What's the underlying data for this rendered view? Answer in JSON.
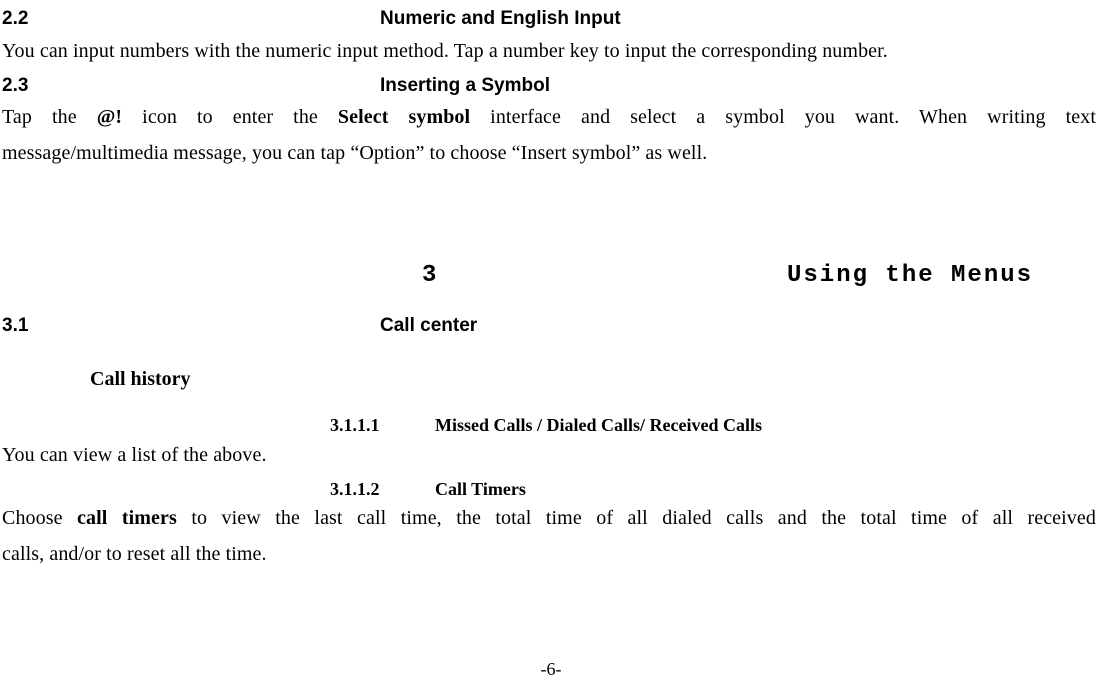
{
  "s22": {
    "num": "2.2",
    "title": "Numeric and English Input",
    "text": "You can input numbers with the numeric input method. Tap a number key to input the corresponding number."
  },
  "s23": {
    "num": "2.3",
    "title": "Inserting a Symbol",
    "line1_a": "Tap the ",
    "line1_b": "@!",
    "line1_c": " icon to enter the ",
    "line1_d": "Select symbol",
    "line1_e": " interface and select a symbol you want. When writing text",
    "line2": "message/multimedia message, you can tap “Option” to choose “Insert symbol” as well."
  },
  "chapter": {
    "num": "3",
    "title": "Using the Menus"
  },
  "s31": {
    "num": "3.1",
    "title": "Call center"
  },
  "sub311": {
    "title": "Call history"
  },
  "s3111": {
    "num": "3.1.1.1",
    "title": "Missed Calls / Dialed Calls/ Received Calls",
    "text": "You can view a list of the above."
  },
  "s3112": {
    "num": "3.1.1.2",
    "title": "Call Timers",
    "line1_a": "Choose ",
    "line1_b": "call timers",
    "line1_c": " to view the last call time, the total time of all dialed calls and the total time of all received",
    "line2": "calls, and/or to reset all the time."
  },
  "pagenum": "-6-"
}
